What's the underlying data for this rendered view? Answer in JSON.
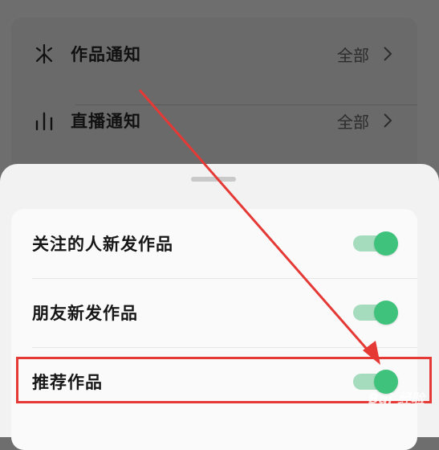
{
  "background_settings": {
    "items": [
      {
        "label": "作品通知",
        "value": "全部",
        "icon": "sparkle-icon"
      },
      {
        "label": "直播通知",
        "value": "全部",
        "icon": "bars-icon"
      }
    ]
  },
  "sheet": {
    "items": [
      {
        "label": "关注的人新发作品",
        "toggle_on": true
      },
      {
        "label": "朋友新发作品",
        "toggle_on": true
      },
      {
        "label": "推荐作品",
        "toggle_on": true
      }
    ]
  },
  "annotation": {
    "highlighted_item": "推荐作品",
    "color": "#e53935"
  },
  "colors": {
    "toggle_on": "#3fc27c",
    "toggle_track": "#a5dcbd",
    "overlay": "#6e6e6e"
  },
  "watermark": "Bai 经验"
}
